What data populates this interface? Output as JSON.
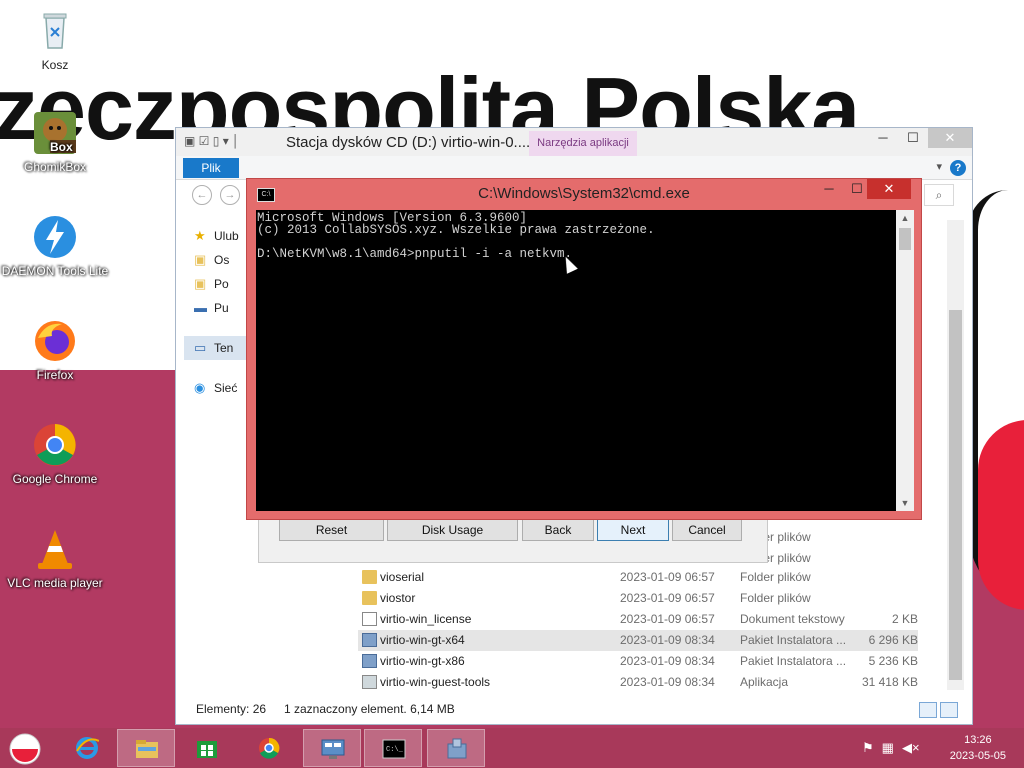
{
  "desktop": {
    "wallpaper_text": "zeczpospolita Polska",
    "icons": [
      {
        "label": "Kosz",
        "icon": "recycle-bin-icon"
      },
      {
        "label": "GhomikBox",
        "badge": "Box",
        "icon": "gnomikbox-icon"
      },
      {
        "label": "DAEMON Tools Lite",
        "icon": "daemon-tools-icon"
      },
      {
        "label": "Firefox",
        "icon": "firefox-icon"
      },
      {
        "label": "Google Chrome",
        "icon": "chrome-icon"
      },
      {
        "label": "VLC media player",
        "icon": "vlc-icon"
      }
    ]
  },
  "explorer": {
    "title": "Stacja dysków CD (D:) virtio-win-0....",
    "tools_tab": "Narzędzia aplikacji",
    "file_tab": "Plik",
    "nav_pane": [
      {
        "label": "Ulub",
        "icon": "star-icon"
      },
      {
        "label": "Os",
        "icon": "folder-icon"
      },
      {
        "label": "Po",
        "icon": "folder-icon"
      },
      {
        "label": "Pu",
        "icon": "desktop-icon"
      },
      {
        "label": "Ten",
        "icon": "computer-icon"
      },
      {
        "label": "Sieć",
        "icon": "network-icon"
      }
    ],
    "partial_rows": [
      {
        "type": "Folder plików"
      },
      {
        "type": "Folder plików"
      }
    ],
    "files": [
      {
        "name": "vioserial",
        "date": "2023-01-09 06:57",
        "type": "Folder plików",
        "size": "",
        "kind": "folder"
      },
      {
        "name": "viostor",
        "date": "2023-01-09 06:57",
        "type": "Folder plików",
        "size": "",
        "kind": "folder"
      },
      {
        "name": "virtio-win_license",
        "date": "2023-01-09 06:57",
        "type": "Dokument tekstowy",
        "size": "2 KB",
        "kind": "doc"
      },
      {
        "name": "virtio-win-gt-x64",
        "date": "2023-01-09 08:34",
        "type": "Pakiet Instalatora ...",
        "size": "6 296 KB",
        "kind": "pkg",
        "selected": true
      },
      {
        "name": "virtio-win-gt-x86",
        "date": "2023-01-09 08:34",
        "type": "Pakiet Instalatora ...",
        "size": "5 236 KB",
        "kind": "pkg"
      },
      {
        "name": "virtio-win-guest-tools",
        "date": "2023-01-09 08:34",
        "type": "Aplikacja",
        "size": "31 418 KB",
        "kind": "app"
      }
    ],
    "status": {
      "count": "Elementy: 26",
      "selection": "1 zaznaczony element. 6,14 MB"
    }
  },
  "installer": {
    "buttons": [
      "Reset",
      "Disk Usage",
      "Back",
      "Next",
      "Cancel"
    ]
  },
  "cmd": {
    "title": "C:\\Windows\\System32\\cmd.exe",
    "icon_text": "C:\\",
    "lines": [
      "Microsoft Windows [Version 6.3.9600]",
      "(c) 2013 CollabSYSOS.xyz. Wszelkie prawa zastrzeżone.",
      "",
      "D:\\NetKVM\\w8.1\\amd64>pnputil -i -a netkvm."
    ]
  },
  "taskbar": {
    "apps": [
      "start-button",
      "ie-icon",
      "file-explorer-icon",
      "store-icon",
      "chrome-icon",
      "control-panel-icon",
      "cmd-icon",
      "installer-icon"
    ],
    "clock": {
      "time": "13:26",
      "date": "2023-05-05"
    }
  },
  "colors": {
    "cmd_frame": "#e46c6c",
    "taskbar": "#a8395a",
    "accent": "#1979ca"
  }
}
